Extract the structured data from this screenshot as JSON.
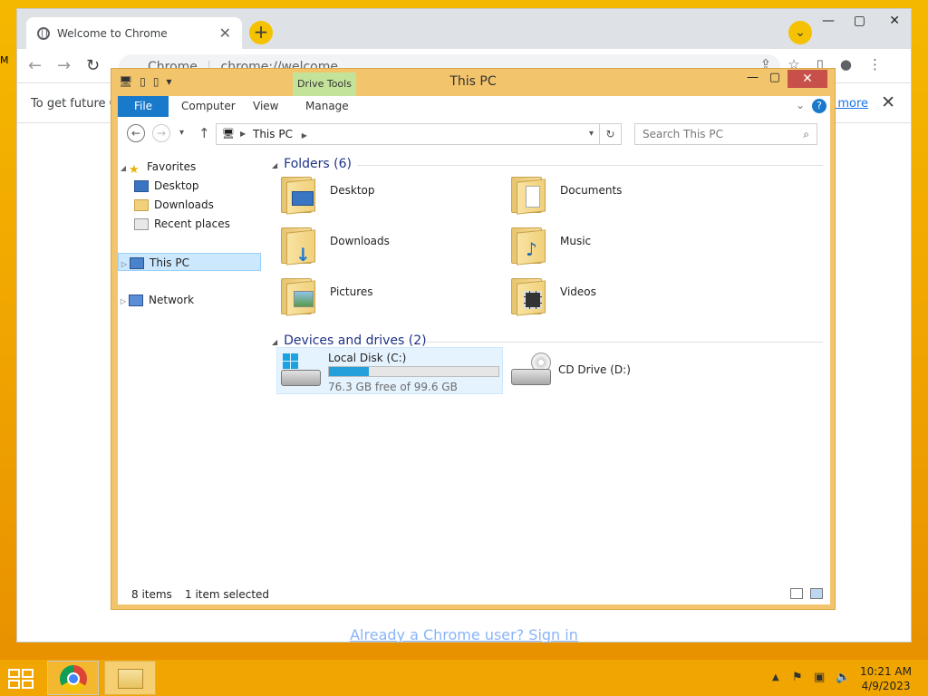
{
  "desktop": {
    "edge_letter": "M"
  },
  "chrome": {
    "tab_title": "Welcome to Chrome",
    "new_tab_label": "+",
    "omnibox_origin": "Chrome",
    "omnibox_url": "chrome://welcome",
    "infobar_text": "To get future Go",
    "infobar_link": "n more",
    "signin_text": "Already a Chrome user? Sign in"
  },
  "explorer": {
    "title": "This PC",
    "context_tab": "Drive Tools",
    "ribbon_tabs": [
      "File",
      "Computer",
      "View",
      "Manage"
    ],
    "address": "This PC",
    "search_placeholder": "Search This PC",
    "nav": {
      "favorites": "Favorites",
      "desktop": "Desktop",
      "downloads": "Downloads",
      "recent": "Recent places",
      "this_pc": "This PC",
      "network": "Network"
    },
    "folders_header": "Folders (6)",
    "folders": [
      "Desktop",
      "Documents",
      "Downloads",
      "Music",
      "Pictures",
      "Videos"
    ],
    "devices_header": "Devices and drives (2)",
    "drives": [
      {
        "name": "Local Disk (C:)",
        "free": "76.3 GB free of 99.6 GB",
        "used_fraction": 0.234
      },
      {
        "name": "CD Drive (D:)"
      }
    ],
    "status_items": "8 items",
    "status_selected": "1 item selected"
  },
  "taskbar": {
    "time": "10:21 AM",
    "date": "4/9/2023"
  },
  "colors": {
    "desktop": "#f1a500",
    "file_tab": "#1979ca",
    "drive_tools": "#c4e39a",
    "close_button": "#c7504a",
    "drive_bar": "#26a0da"
  }
}
